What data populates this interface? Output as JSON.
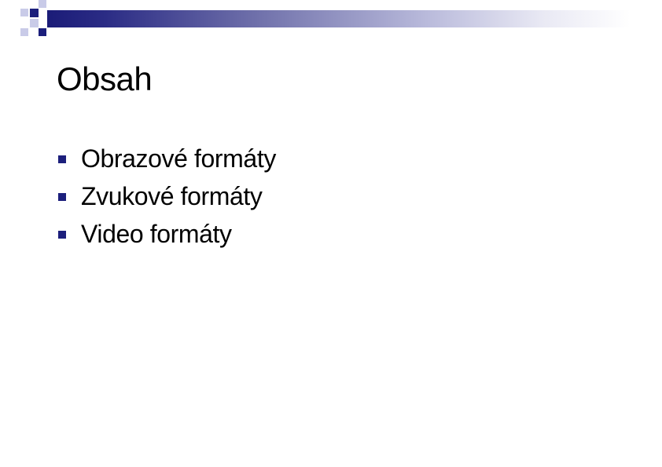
{
  "slide": {
    "title": "Obsah",
    "bullets": [
      {
        "label": "Obrazové formáty"
      },
      {
        "label": "Zvukové formáty"
      },
      {
        "label": "Video formáty"
      }
    ]
  },
  "theme": {
    "accent_dark": "#1c1f7c",
    "accent_light": "#c9cbe8",
    "bullet_icon": "square-bullet-icon"
  }
}
